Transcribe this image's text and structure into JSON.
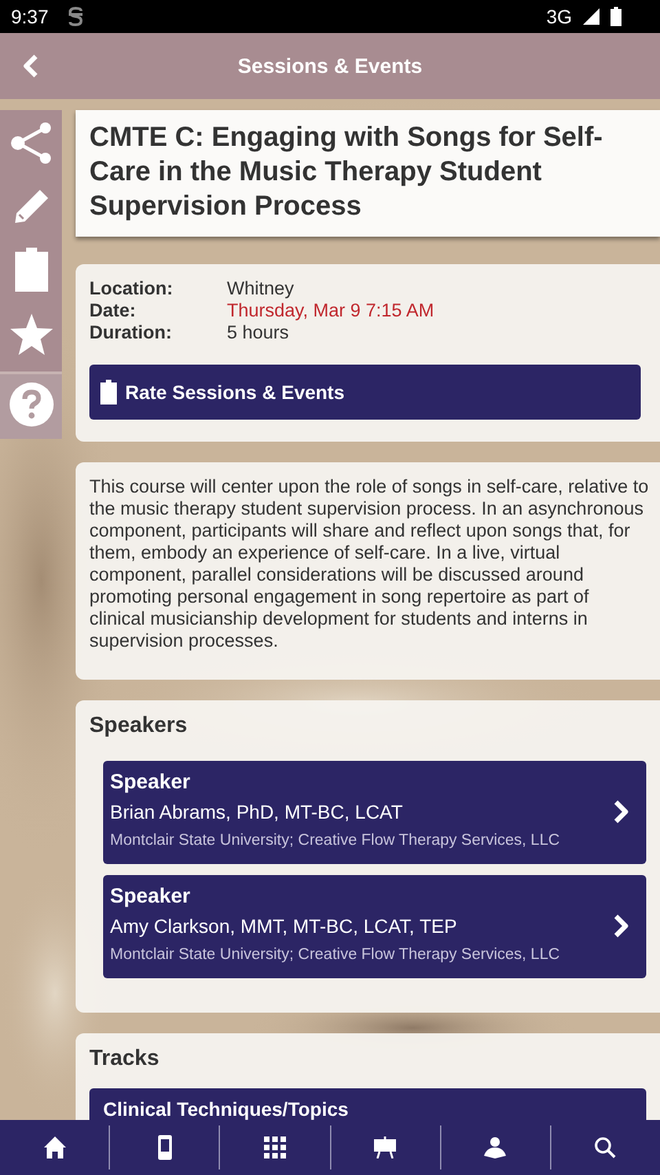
{
  "status_bar": {
    "time": "9:37",
    "network": "3G"
  },
  "header": {
    "title": "Sessions & Events"
  },
  "session": {
    "title": "CMTE C: Engaging with Songs for Self-Care in the Music Therapy Student Supervision Process",
    "details": [
      {
        "label": "Location:",
        "value": "Whitney",
        "kind": "plain"
      },
      {
        "label": "Date:",
        "value": "Thursday, Mar 9 7:15 AM",
        "kind": "date"
      },
      {
        "label": "Duration:",
        "value": "5 hours",
        "kind": "plain"
      }
    ],
    "rate_button": "Rate Sessions & Events",
    "description": "This course will center upon the role of songs in self-care, relative to the music therapy student supervision process. In an asynchronous component, participants will share and reflect upon songs that, for them, embody an experience of self-care. In a live, virtual component, parallel considerations will be discussed around promoting personal engagement in song repertoire as part of clinical musicianship development for students and interns in supervision processes."
  },
  "speakers": {
    "heading": "Speakers",
    "items": [
      {
        "role": "Speaker",
        "name": "Brian Abrams, PhD, MT-BC, LCAT",
        "affiliation": "Montclair State University; Creative Flow Therapy Services, LLC"
      },
      {
        "role": "Speaker",
        "name": "Amy Clarkson, MMT, MT-BC, LCAT, TEP",
        "affiliation": "Montclair State University; Creative Flow Therapy Services, LLC"
      }
    ]
  },
  "tracks": {
    "heading": "Tracks",
    "items": [
      "Clinical Techniques/Topics"
    ]
  }
}
